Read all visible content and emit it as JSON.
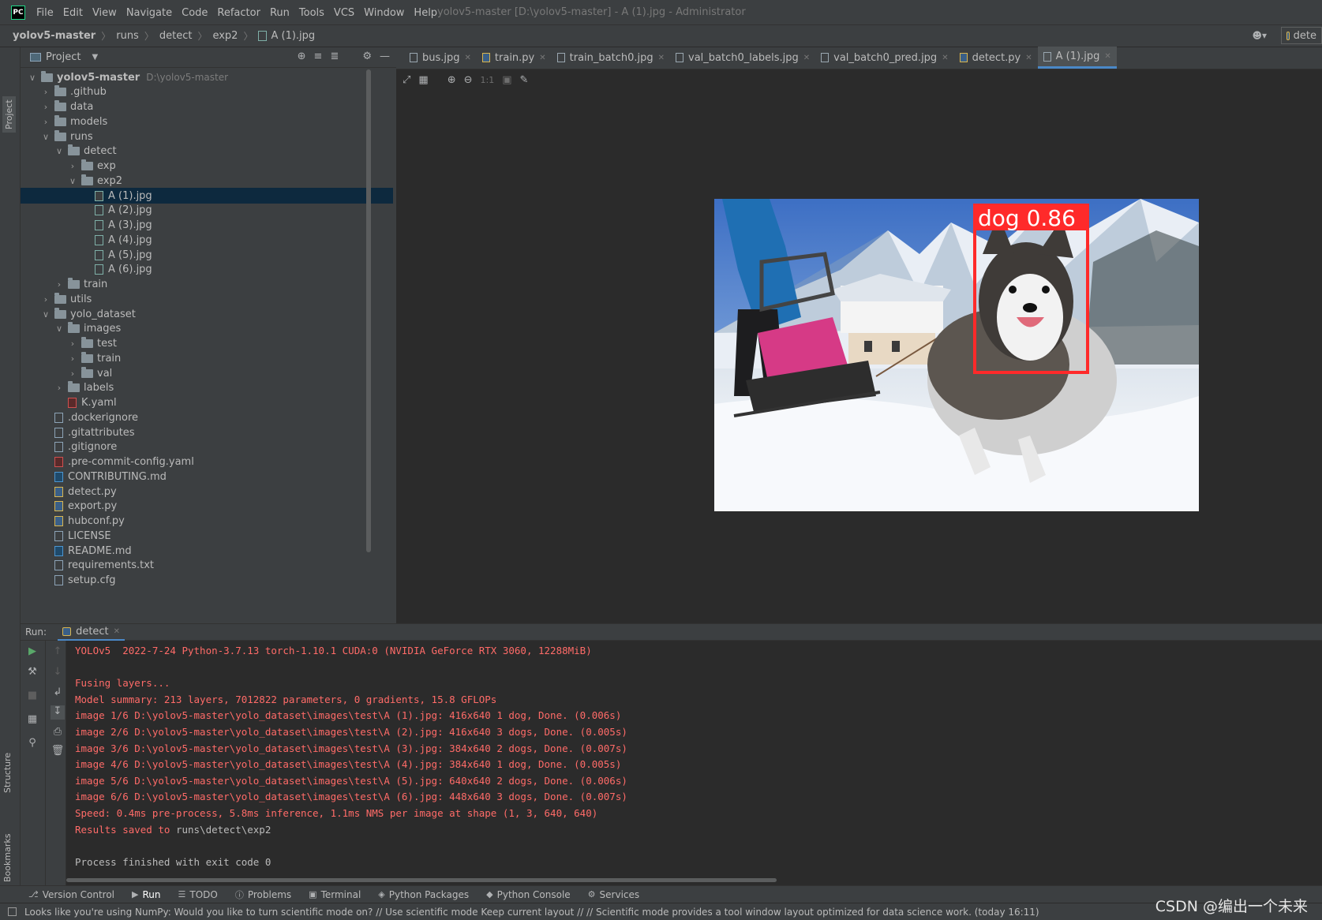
{
  "menubar": {
    "logo": "PC",
    "items": [
      "File",
      "Edit",
      "View",
      "Navigate",
      "Code",
      "Refactor",
      "Run",
      "Tools",
      "VCS",
      "Window",
      "Help"
    ],
    "window_title": "yolov5-master [D:\\yolov5-master] - A (1).jpg - Administrator"
  },
  "breadcrumb": [
    "yolov5-master",
    "runs",
    "detect",
    "exp2",
    "A (1).jpg"
  ],
  "run_config": "dete",
  "side_labels": {
    "project": "Project",
    "structure": "Structure",
    "bookmarks": "Bookmarks"
  },
  "project_panel": {
    "title": "Project",
    "root_path": "D:\\yolov5-master",
    "tree": [
      {
        "label": "yolov5-master",
        "type": "folder",
        "depth": 0,
        "expanded": true
      },
      {
        "label": ".github",
        "type": "folder",
        "depth": 1,
        "expanded": false
      },
      {
        "label": "data",
        "type": "folder",
        "depth": 1,
        "expanded": false
      },
      {
        "label": "models",
        "type": "folder",
        "depth": 1,
        "expanded": false
      },
      {
        "label": "runs",
        "type": "folder",
        "depth": 1,
        "expanded": true
      },
      {
        "label": "detect",
        "type": "folder",
        "depth": 2,
        "expanded": true
      },
      {
        "label": "exp",
        "type": "folder",
        "depth": 3,
        "expanded": false
      },
      {
        "label": "exp2",
        "type": "folder",
        "depth": 3,
        "expanded": true
      },
      {
        "label": "A (1).jpg",
        "type": "img",
        "depth": 4,
        "selected": true
      },
      {
        "label": "A (2).jpg",
        "type": "img",
        "depth": 4
      },
      {
        "label": "A (3).jpg",
        "type": "img",
        "depth": 4
      },
      {
        "label": "A (4).jpg",
        "type": "img",
        "depth": 4
      },
      {
        "label": "A (5).jpg",
        "type": "img",
        "depth": 4
      },
      {
        "label": "A (6).jpg",
        "type": "img",
        "depth": 4
      },
      {
        "label": "train",
        "type": "folder",
        "depth": 2,
        "expanded": false
      },
      {
        "label": "utils",
        "type": "folder",
        "depth": 1,
        "expanded": false
      },
      {
        "label": "yolo_dataset",
        "type": "folder",
        "depth": 1,
        "expanded": true
      },
      {
        "label": "images",
        "type": "folder",
        "depth": 2,
        "expanded": true
      },
      {
        "label": "test",
        "type": "folder",
        "depth": 3,
        "expanded": false
      },
      {
        "label": "train",
        "type": "folder",
        "depth": 3,
        "expanded": false
      },
      {
        "label": "val",
        "type": "folder",
        "depth": 3,
        "expanded": false
      },
      {
        "label": "labels",
        "type": "folder",
        "depth": 2,
        "expanded": false
      },
      {
        "label": "K.yaml",
        "type": "yaml",
        "depth": 2
      },
      {
        "label": ".dockerignore",
        "type": "txt",
        "depth": 1
      },
      {
        "label": ".gitattributes",
        "type": "txt",
        "depth": 1
      },
      {
        "label": ".gitignore",
        "type": "txt",
        "depth": 1
      },
      {
        "label": ".pre-commit-config.yaml",
        "type": "yaml",
        "depth": 1
      },
      {
        "label": "CONTRIBUTING.md",
        "type": "md",
        "depth": 1
      },
      {
        "label": "detect.py",
        "type": "py",
        "depth": 1
      },
      {
        "label": "export.py",
        "type": "py",
        "depth": 1
      },
      {
        "label": "hubconf.py",
        "type": "py",
        "depth": 1
      },
      {
        "label": "LICENSE",
        "type": "txt",
        "depth": 1
      },
      {
        "label": "README.md",
        "type": "md",
        "depth": 1
      },
      {
        "label": "requirements.txt",
        "type": "txt",
        "depth": 1
      },
      {
        "label": "setup.cfg",
        "type": "txt",
        "depth": 1
      }
    ]
  },
  "editor": {
    "tabs": [
      {
        "label": "bus.jpg",
        "type": "img"
      },
      {
        "label": "train.py",
        "type": "py"
      },
      {
        "label": "train_batch0.jpg",
        "type": "img"
      },
      {
        "label": "val_batch0_labels.jpg",
        "type": "img"
      },
      {
        "label": "val_batch0_pred.jpg",
        "type": "img"
      },
      {
        "label": "detect.py",
        "type": "py"
      },
      {
        "label": "A (1).jpg",
        "type": "img",
        "active": true
      }
    ],
    "zoom_label": "1:1",
    "detection_label": "dog  0.86",
    "box_color": "#ff2a2a"
  },
  "run_panel": {
    "label": "Run:",
    "tab": "detect",
    "console": [
      {
        "text": "YOLOv5  2022-7-24 Python-3.7.13 torch-1.10.1 CUDA:0 (NVIDIA GeForce RTX 3060, 12288MiB)"
      },
      {
        "text": ""
      },
      {
        "text": "Fusing layers..."
      },
      {
        "text": "Model summary: 213 layers, 7012822 parameters, 0 gradients, 15.8 GFLOPs"
      },
      {
        "text": "image 1/6 D:\\yolov5-master\\yolo_dataset\\images\\test\\A (1).jpg: 416x640 1 dog, Done. (0.006s)"
      },
      {
        "text": "image 2/6 D:\\yolov5-master\\yolo_dataset\\images\\test\\A (2).jpg: 416x640 3 dogs, Done. (0.005s)"
      },
      {
        "text": "image 3/6 D:\\yolov5-master\\yolo_dataset\\images\\test\\A (3).jpg: 384x640 2 dogs, Done. (0.007s)"
      },
      {
        "text": "image 4/6 D:\\yolov5-master\\yolo_dataset\\images\\test\\A (4).jpg: 384x640 1 dog, Done. (0.005s)"
      },
      {
        "text": "image 5/6 D:\\yolov5-master\\yolo_dataset\\images\\test\\A (5).jpg: 640x640 2 dogs, Done. (0.006s)"
      },
      {
        "text": "image 6/6 D:\\yolov5-master\\yolo_dataset\\images\\test\\A (6).jpg: 448x640 3 dogs, Done. (0.007s)"
      },
      {
        "text": "Speed: 0.4ms pre-process, 5.8ms inference, 1.1ms NMS per image at shape (1, 3, 640, 640)"
      },
      {
        "prefix": "Results saved to ",
        "path": "runs\\detect\\exp2"
      },
      {
        "text": ""
      },
      {
        "text": "Process finished with exit code 0",
        "white": true
      }
    ]
  },
  "toolwindows": [
    {
      "label": "Version Control",
      "icon": "branch-icon"
    },
    {
      "label": "Run",
      "icon": "run-icon",
      "active": true
    },
    {
      "label": "TODO",
      "icon": "list-icon"
    },
    {
      "label": "Problems",
      "icon": "info-icon"
    },
    {
      "label": "Terminal",
      "icon": "terminal-icon"
    },
    {
      "label": "Python Packages",
      "icon": "layers-icon"
    },
    {
      "label": "Python Console",
      "icon": "python-icon"
    },
    {
      "label": "Services",
      "icon": "services-icon"
    }
  ],
  "status": "Looks like you're using NumPy: Would you like to turn scientific mode on? // Use scientific mode   Keep current layout // // Scientific mode provides a tool window layout optimized for data science work. (today 16:11)",
  "watermark": "CSDN @编出一个未来"
}
